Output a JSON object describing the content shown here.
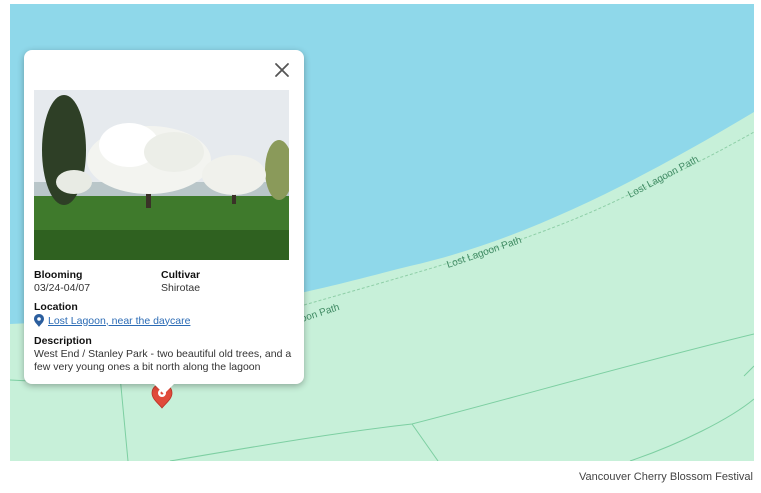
{
  "map": {
    "path_labels": [
      "Lost Lagoon Path",
      "Lost Lagoon Path",
      "oon Path"
    ],
    "colors": {
      "water": "#8fd8ea",
      "land": "#c7f0d9",
      "paths": "#7dcfa2",
      "marker": "#e04a3a"
    }
  },
  "popup": {
    "close_icon": "close-icon",
    "photo_icon": "cherry-tree-photo",
    "blooming_label": "Blooming",
    "blooming_value": "03/24-04/07",
    "cultivar_label": "Cultivar",
    "cultivar_value": "Shirotae",
    "location_label": "Location",
    "location_link": "Lost Lagoon, near the daycare",
    "description_label": "Description",
    "description_text": "West End / Stanley Park - two beautiful old trees, and a few very young ones a bit north along the lagoon"
  },
  "caption": "Vancouver Cherry Blossom Festival"
}
